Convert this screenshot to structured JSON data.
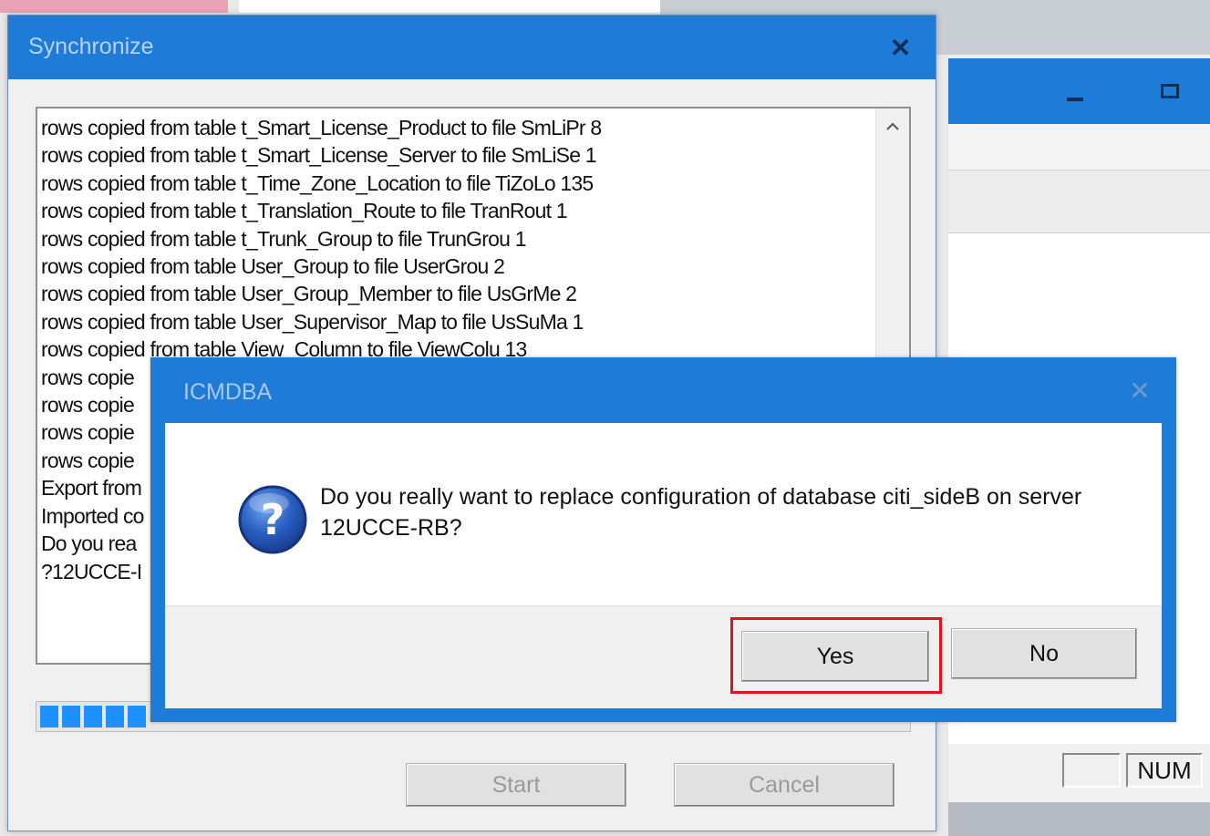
{
  "background": {
    "status_cells": [
      "",
      "NUM"
    ]
  },
  "synchronize": {
    "title": "Synchronize",
    "close_label": "✕",
    "log_lines": [
      "rows copied from table t_Smart_License_Product to file SmLiPr 8",
      "rows copied from table t_Smart_License_Server to file SmLiSe 1",
      "rows copied from table t_Time_Zone_Location to file TiZoLo 135",
      "rows copied from table t_Translation_Route to file TranRout 1",
      "rows copied from table t_Trunk_Group to file TrunGrou 1",
      "rows copied from table User_Group to file UserGrou 2",
      "rows copied from table User_Group_Member to file UsGrMe 2",
      "rows copied from table User_Supervisor_Map to file UsSuMa 1",
      "rows copied from table View_Column to file ViewColu 13",
      "rows copie",
      "rows copie",
      "rows copie",
      "rows copie",
      "Export from",
      "Imported co",
      " Do you rea",
      "?12UCCE-I"
    ],
    "progress_blocks": 5,
    "start_label": "Start",
    "cancel_label": "Cancel"
  },
  "dialog": {
    "title": "ICMDBA",
    "close_label": "✕",
    "message": "Do you really want to replace configuration of database citi_sideB on server 12UCCE-RB?",
    "yes_label": "Yes",
    "no_label": "No",
    "icon": "question-icon"
  },
  "colors": {
    "title_bar": "#1e7bd8",
    "highlight": "#e0121b",
    "progress": "#1e90ff"
  }
}
